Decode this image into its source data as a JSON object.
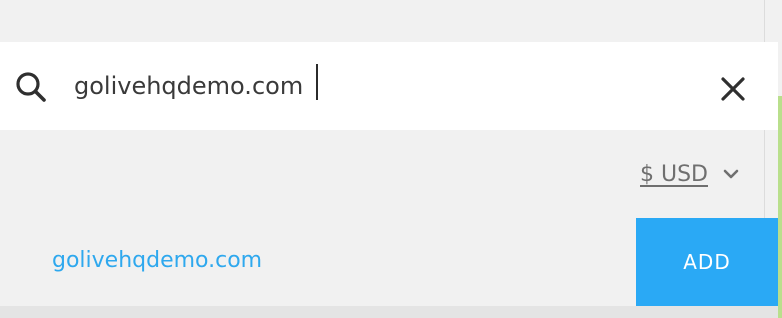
{
  "search": {
    "value": "golivehqdemo.com",
    "icon": "search-icon",
    "clear_icon": "close-icon"
  },
  "currency": {
    "label": "$ USD",
    "icon": "chevron-down-icon"
  },
  "result": {
    "domain": "golivehqdemo.com",
    "add_label": "ADD"
  },
  "colors": {
    "accent": "#2aa9f5",
    "link": "#2ea8ee",
    "text": "#3a3a3a",
    "muted": "#6f6f6f",
    "background": "#f1f1f1"
  }
}
